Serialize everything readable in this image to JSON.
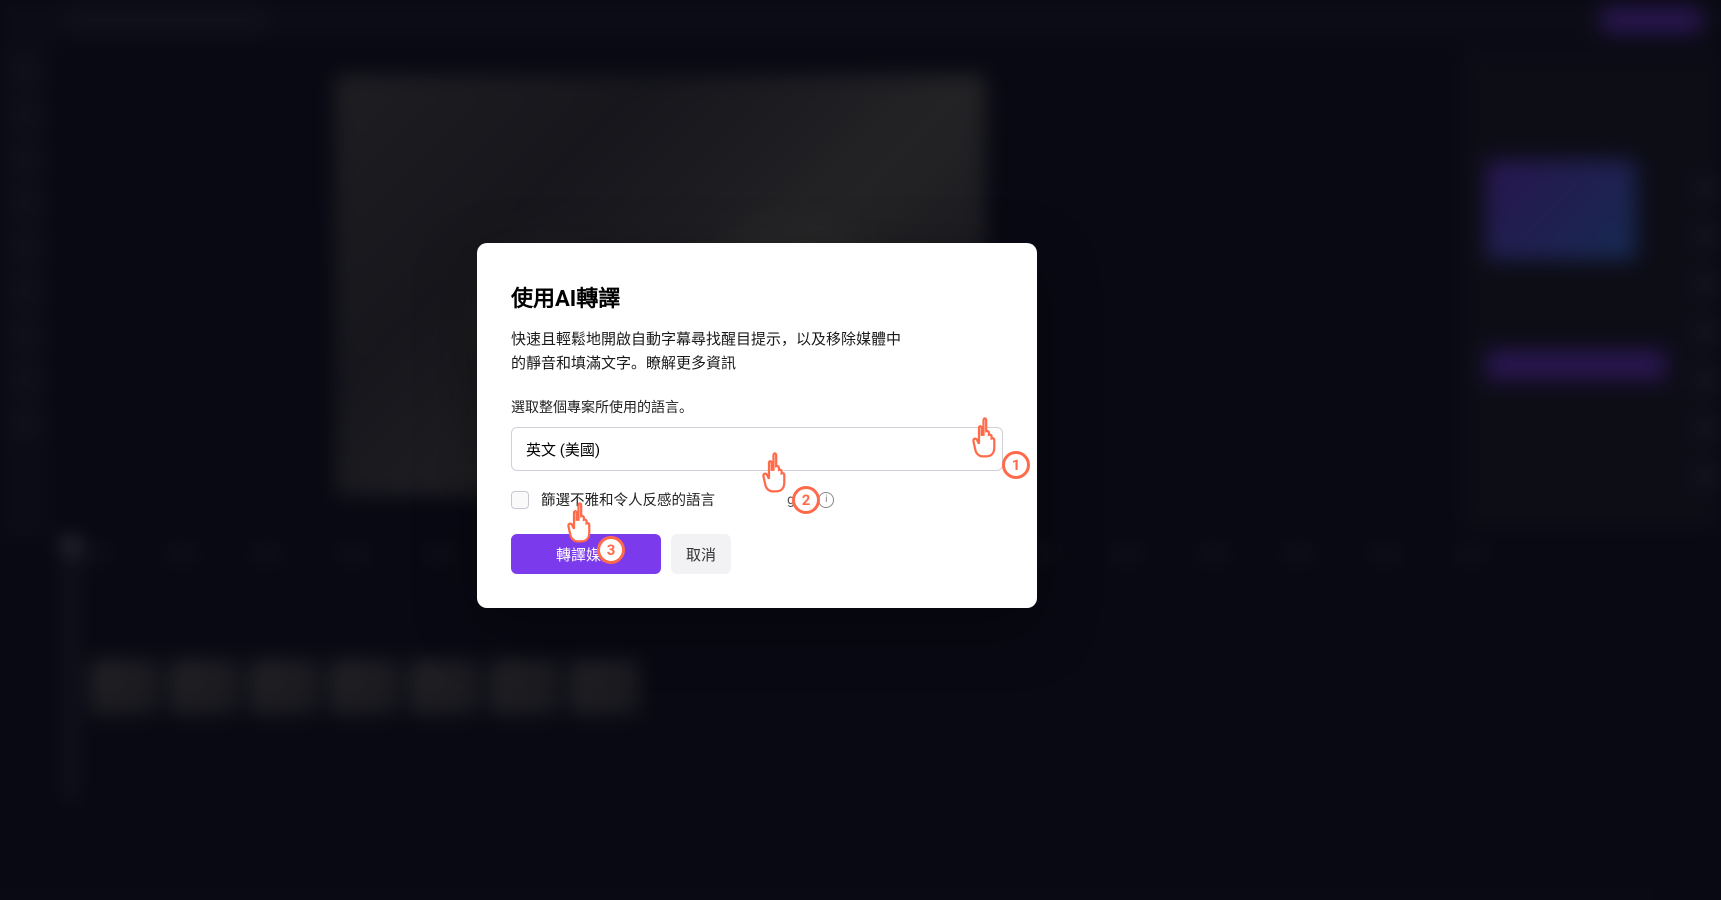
{
  "modal": {
    "title": "使用AI轉譯",
    "description": "快速且輕鬆地開啟自動字幕尋找醒目提示，以及移除媒體中的靜音和填滿文字。瞭解更多資訊",
    "selectLangLabel": "選取整個專案所使用的語言。",
    "selectedLang": "英文 (美國)",
    "filterLabel": "篩選不雅和令人反感的語言",
    "geText": "ge",
    "primaryButton": "轉譯媒體",
    "cancelButton": "取消"
  },
  "annotations": {
    "p1": "1",
    "p2": "2",
    "p3": "3"
  }
}
